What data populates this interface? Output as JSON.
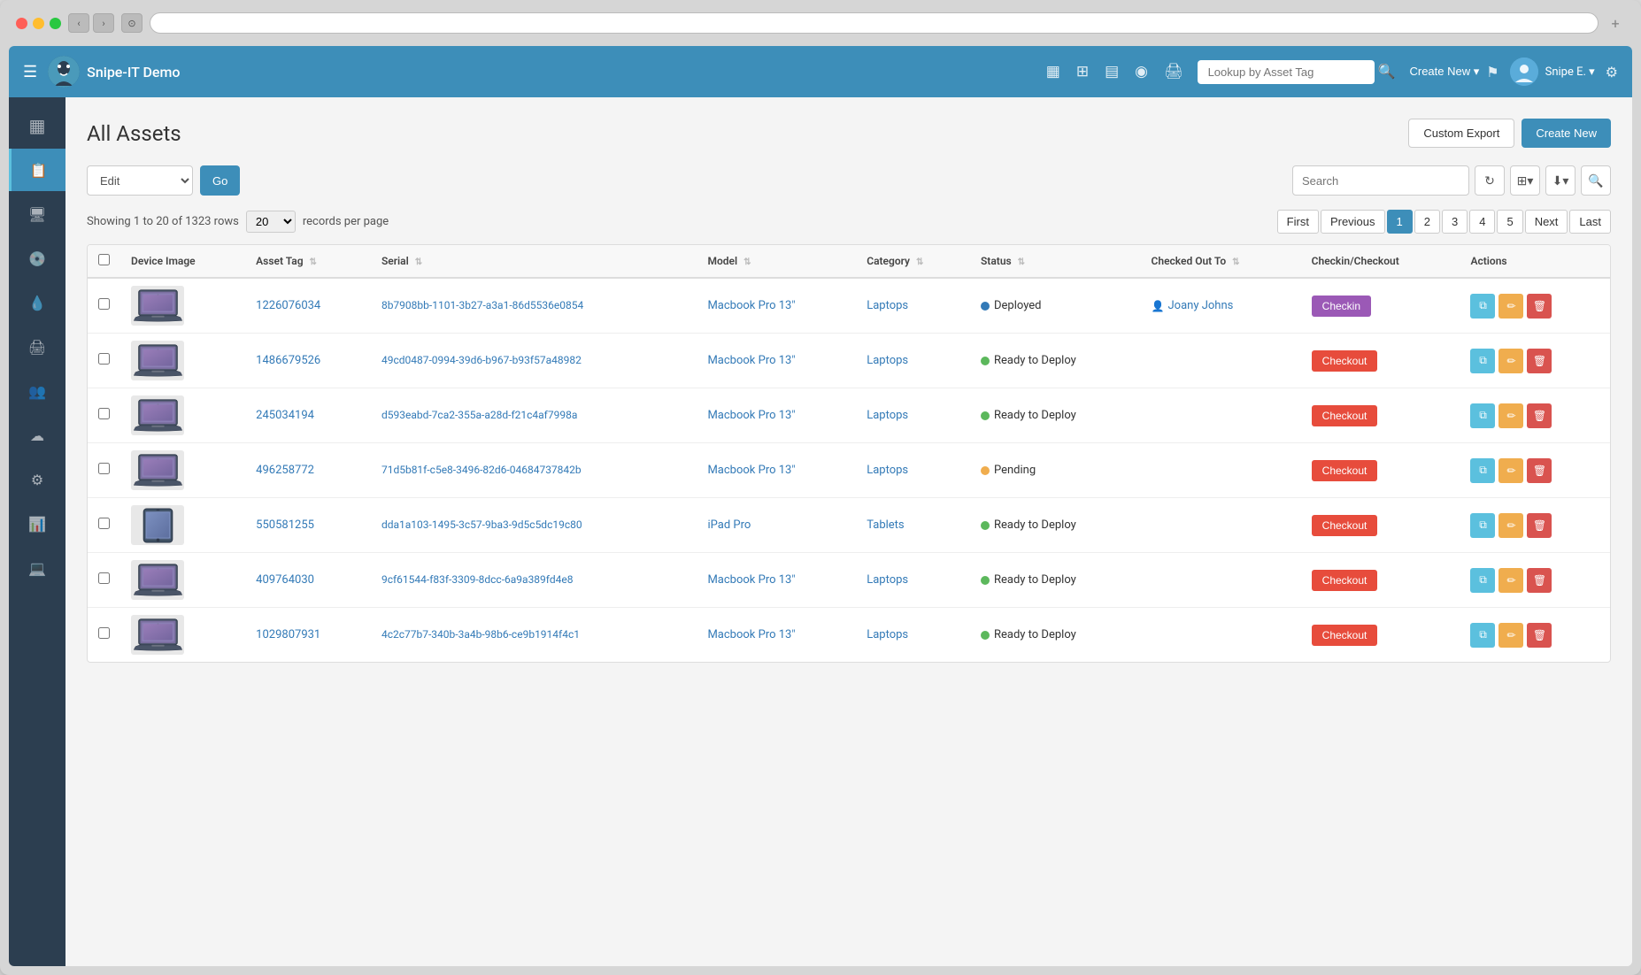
{
  "browser": {
    "new_tab_label": "+"
  },
  "app": {
    "name": "Snipe-IT Demo"
  },
  "nav": {
    "search_placeholder": "Lookup by Asset Tag",
    "create_new": "Create New ▾",
    "user_name": "Snipe E. ▾",
    "icons": [
      "▦",
      "⊞",
      "▤",
      "◉",
      "🖨"
    ]
  },
  "page": {
    "title": "All Assets",
    "custom_export": "Custom Export",
    "create_new": "Create New"
  },
  "toolbar": {
    "edit_label": "Edit",
    "go_label": "Go",
    "search_placeholder": "Search"
  },
  "records": {
    "showing_text": "Showing 1 to 20 of 1323 rows",
    "per_page": "20",
    "per_page_suffix": "records per page"
  },
  "pagination": {
    "first": "First",
    "previous": "Previous",
    "pages": [
      "1",
      "2",
      "3",
      "4",
      "5"
    ],
    "active_page": "1",
    "next": "Next",
    "last": "Last"
  },
  "table": {
    "columns": [
      "Device Image",
      "Asset Tag",
      "Serial",
      "Model",
      "Category",
      "Status",
      "Checked Out To",
      "Checkin/Checkout",
      "Actions"
    ],
    "rows": [
      {
        "id": 1,
        "asset_tag": "1226076034",
        "serial": "8b7908bb-1101-3b27-a3a1-86d5536e0854",
        "model": "Macbook Pro 13\"",
        "category": "Laptops",
        "status": "Deployed",
        "status_type": "deployed",
        "checked_out_to": "Joany Johns",
        "action_type": "checkin",
        "device_type": "laptop"
      },
      {
        "id": 2,
        "asset_tag": "1486679526",
        "serial": "49cd0487-0994-39d6-b967-b93f57a48982",
        "model": "Macbook Pro 13\"",
        "category": "Laptops",
        "status": "Ready to Deploy",
        "status_type": "ready",
        "checked_out_to": "",
        "action_type": "checkout",
        "device_type": "laptop"
      },
      {
        "id": 3,
        "asset_tag": "245034194",
        "serial": "d593eabd-7ca2-355a-a28d-f21c4af7998a",
        "model": "Macbook Pro 13\"",
        "category": "Laptops",
        "status": "Ready to Deploy",
        "status_type": "ready",
        "checked_out_to": "",
        "action_type": "checkout",
        "device_type": "laptop"
      },
      {
        "id": 4,
        "asset_tag": "496258772",
        "serial": "71d5b81f-c5e8-3496-82d6-04684737842b",
        "model": "Macbook Pro 13\"",
        "category": "Laptops",
        "status": "Pending",
        "status_type": "pending",
        "checked_out_to": "",
        "action_type": "checkout",
        "device_type": "laptop"
      },
      {
        "id": 5,
        "asset_tag": "550581255",
        "serial": "dda1a103-1495-3c57-9ba3-9d5c5dc19c80",
        "model": "iPad Pro",
        "category": "Tablets",
        "status": "Ready to Deploy",
        "status_type": "ready",
        "checked_out_to": "",
        "action_type": "checkout",
        "device_type": "tablet"
      },
      {
        "id": 6,
        "asset_tag": "409764030",
        "serial": "9cf61544-f83f-3309-8dcc-6a9a389fd4e8",
        "model": "Macbook Pro 13\"",
        "category": "Laptops",
        "status": "Ready to Deploy",
        "status_type": "ready",
        "checked_out_to": "",
        "action_type": "checkout",
        "device_type": "laptop"
      },
      {
        "id": 7,
        "asset_tag": "1029807931",
        "serial": "4c2c77b7-340b-3a4b-98b6-ce9b1914f4c1",
        "model": "Macbook Pro 13\"",
        "category": "Laptops",
        "status": "Ready to Deploy",
        "status_type": "ready",
        "checked_out_to": "",
        "action_type": "checkout",
        "device_type": "laptop"
      }
    ]
  },
  "sidebar": {
    "items": [
      {
        "icon": "☰",
        "name": "menu"
      },
      {
        "icon": "▦",
        "name": "dashboard"
      },
      {
        "icon": "📋",
        "name": "assets"
      },
      {
        "icon": "🖥",
        "name": "hardware"
      },
      {
        "icon": "💿",
        "name": "software"
      },
      {
        "icon": "💧",
        "name": "consumables"
      },
      {
        "icon": "🖨",
        "name": "accessories"
      },
      {
        "icon": "👥",
        "name": "users"
      },
      {
        "icon": "☁",
        "name": "cloud"
      },
      {
        "icon": "⚙",
        "name": "settings"
      },
      {
        "icon": "📊",
        "name": "reports"
      },
      {
        "icon": "💻",
        "name": "devices"
      }
    ]
  }
}
